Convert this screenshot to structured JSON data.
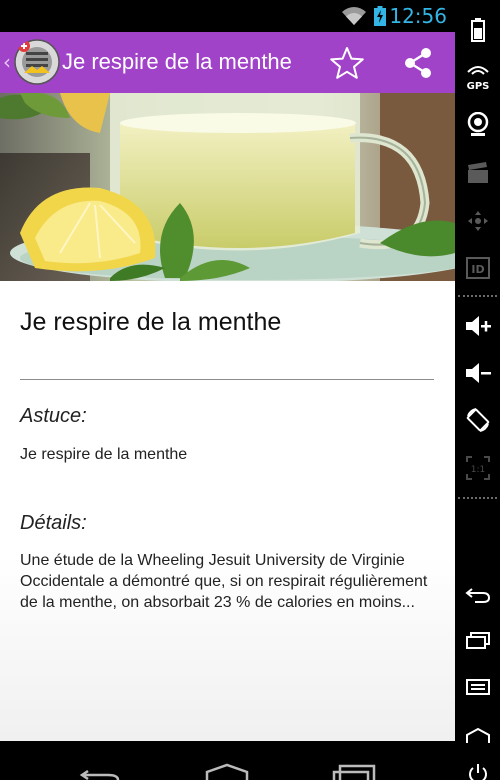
{
  "status_bar": {
    "time": "12:56"
  },
  "action_bar": {
    "title": "Je respire de la menthe"
  },
  "content": {
    "title": "Je respire de la menthe",
    "tip_label": "Astuce:",
    "tip_text": "Je respire de la menthe",
    "details_label": "Détails:",
    "details_text": "Une étude de la Wheeling Jesuit University de Virginie Occidentale a démontré que, si on respirait régulièrement de la menthe, on absorbait 23 % de calories en moins..."
  },
  "side_panel": {
    "gps_label": "GPS",
    "id_label": "ID",
    "scale_label": "1:1"
  },
  "colors": {
    "action_bar": "#a043c8",
    "status_time": "#33b5e5"
  }
}
